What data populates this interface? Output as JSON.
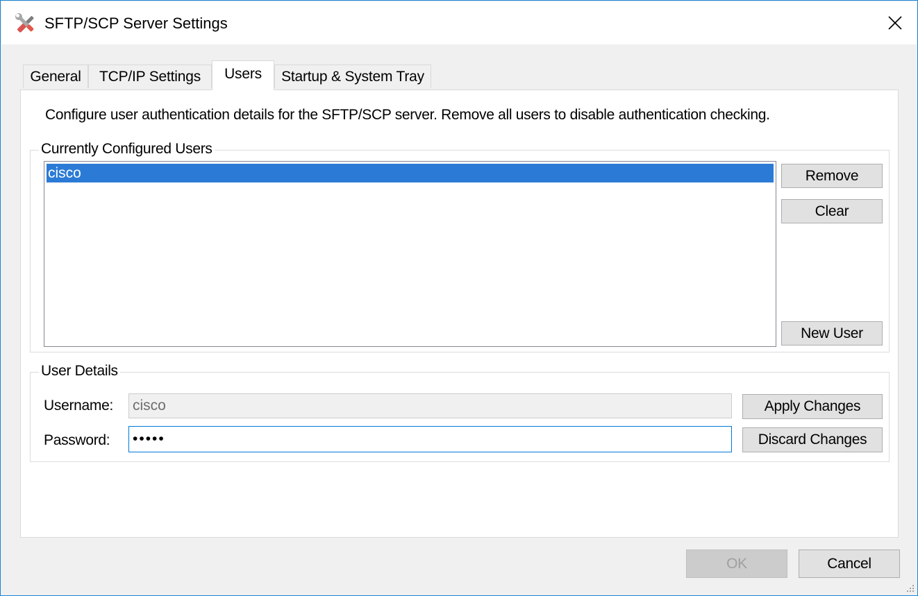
{
  "window": {
    "title": "SFTP/SCP Server Settings",
    "app_icon": "tools-icon",
    "close_glyph": "✕"
  },
  "tabs": [
    {
      "label": "General",
      "active": false
    },
    {
      "label": "TCP/IP Settings",
      "active": false
    },
    {
      "label": "Users",
      "active": true
    },
    {
      "label": "Startup & System Tray",
      "active": false
    }
  ],
  "users_tab": {
    "description": "Configure user authentication details for the SFTP/SCP server.  Remove all users to disable authentication checking.",
    "configured_users": {
      "group_label": "Currently Configured Users",
      "items": [
        "cisco"
      ],
      "selected": "cisco",
      "remove_label": "Remove",
      "clear_label": "Clear",
      "new_user_label": "New User"
    },
    "user_details": {
      "group_label": "User Details",
      "username_label": "Username:",
      "username_value": "cisco",
      "password_label": "Password:",
      "password_value": "•••••",
      "apply_label": "Apply Changes",
      "discard_label": "Discard Changes"
    }
  },
  "footer": {
    "ok_label": "OK",
    "cancel_label": "Cancel"
  },
  "colors": {
    "accent": "#0078d7",
    "selection": "#2b7bd6",
    "window_border": "#1883d7"
  }
}
